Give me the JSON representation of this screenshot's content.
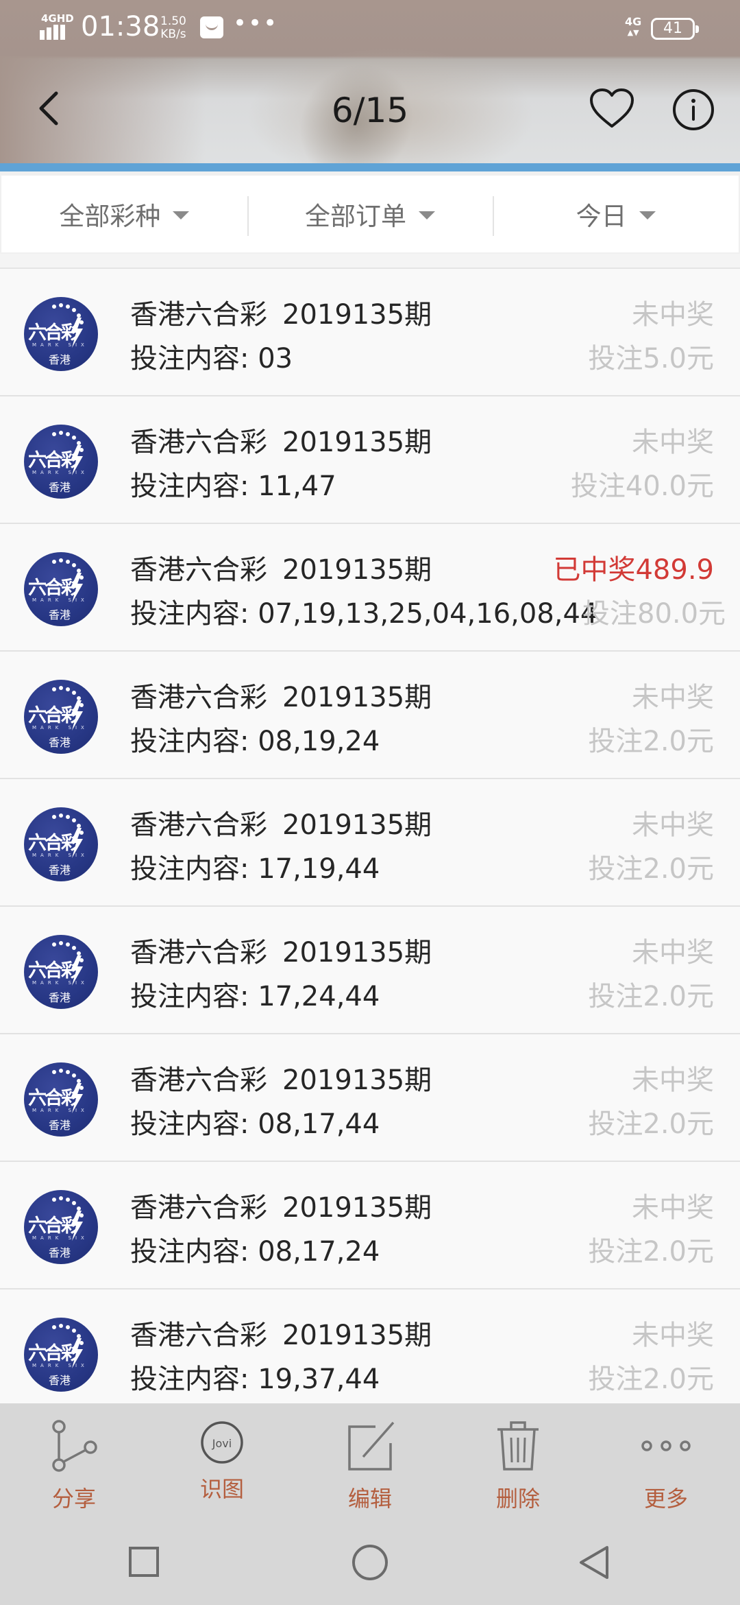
{
  "status_bar": {
    "network_label": "4GHD",
    "time": "01:38",
    "speed_value": "1.50",
    "speed_unit": "KB/s",
    "more_dots": "•••",
    "net_type": "4G",
    "battery": "41"
  },
  "header": {
    "counter": "6/15"
  },
  "filters": [
    {
      "label": "全部彩种"
    },
    {
      "label": "全部订单"
    },
    {
      "label": "今日"
    }
  ],
  "logo": {
    "text_cn": "六合彩",
    "text_en": "MARK SIX",
    "text_hk": "香港"
  },
  "orders": [
    {
      "lottery": "香港六合彩",
      "period": "2019135期",
      "content": "投注内容: 03",
      "status": "未中奖",
      "amount": "投注5.0元",
      "won": false
    },
    {
      "lottery": "香港六合彩",
      "period": "2019135期",
      "content": "投注内容: 11,47",
      "status": "未中奖",
      "amount": "投注40.0元",
      "won": false
    },
    {
      "lottery": "香港六合彩",
      "period": "2019135期",
      "content": "投注内容: 07,19,13,25,04,16,08,44",
      "status": "已中奖489.9",
      "amount": "投注80.0元",
      "won": true
    },
    {
      "lottery": "香港六合彩",
      "period": "2019135期",
      "content": "投注内容: 08,19,24",
      "status": "未中奖",
      "amount": "投注2.0元",
      "won": false
    },
    {
      "lottery": "香港六合彩",
      "period": "2019135期",
      "content": "投注内容: 17,19,44",
      "status": "未中奖",
      "amount": "投注2.0元",
      "won": false
    },
    {
      "lottery": "香港六合彩",
      "period": "2019135期",
      "content": "投注内容: 17,24,44",
      "status": "未中奖",
      "amount": "投注2.0元",
      "won": false
    },
    {
      "lottery": "香港六合彩",
      "period": "2019135期",
      "content": "投注内容: 08,17,44",
      "status": "未中奖",
      "amount": "投注2.0元",
      "won": false
    },
    {
      "lottery": "香港六合彩",
      "period": "2019135期",
      "content": "投注内容: 08,17,24",
      "status": "未中奖",
      "amount": "投注2.0元",
      "won": false
    },
    {
      "lottery": "香港六合彩",
      "period": "2019135期",
      "content": "投注内容: 19,37,44",
      "status": "未中奖",
      "amount": "投注2.0元",
      "won": false
    }
  ],
  "toolbar": {
    "share": "分享",
    "jovi": "识图",
    "jovi_badge": "Jovi",
    "edit": "编辑",
    "delete": "删除",
    "more": "更多"
  },
  "colors": {
    "win_red": "#d23a36",
    "muted_gray": "#c6c6c6",
    "toolbar_label": "#b45e3e",
    "accent_blue": "#5fa3d6",
    "logo_blue": "#273785"
  },
  "icons": [
    "back-icon",
    "heart-icon",
    "info-icon",
    "share-icon",
    "jovi-icon",
    "edit-icon",
    "delete-icon",
    "more-icon"
  ]
}
